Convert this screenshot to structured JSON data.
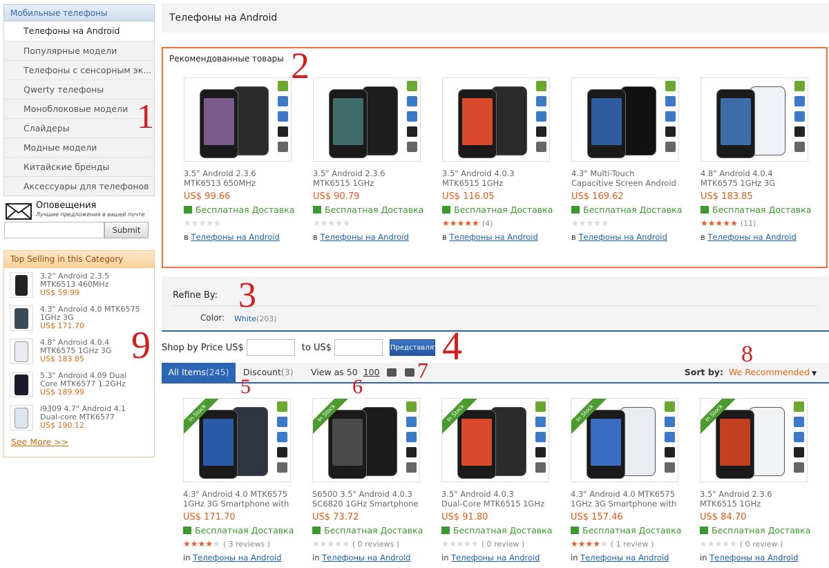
{
  "sidebar": {
    "header": "Мобильные телефоны",
    "items": [
      {
        "label": "Телефоны на Android",
        "active": true
      },
      {
        "label": "Популярные модели"
      },
      {
        "label": "Телефоны с сенсорным эк..."
      },
      {
        "label": "Qwerty телефоны"
      },
      {
        "label": "Моноблоковые модели"
      },
      {
        "label": "Слайдеры"
      },
      {
        "label": "Модные модели"
      },
      {
        "label": "Китайские бренды"
      },
      {
        "label": "Аксессуары для телефонов"
      }
    ]
  },
  "notify": {
    "title": "Оповещения",
    "subtitle": "Лучшие предложения в вашей почте",
    "input_value": "",
    "submit_label": "Submit"
  },
  "top_selling": {
    "header": "Top Selling in this Category",
    "items": [
      {
        "name": "3.2\" Android 2.3.5 MTK6513 460MHz",
        "price": "US$ 59.99"
      },
      {
        "name": "4.3\" Android 4.0 MTK6575 1GHz 3G",
        "price": "US$ 171.70"
      },
      {
        "name": "4.8\" Android 4.0.4 MTK6575 1GHz 3G",
        "price": "US$ 183.85"
      },
      {
        "name": "5.3\" Android 4.09 Dual Core MTK6577 1.2GHz",
        "price": "US$ 189.99"
      },
      {
        "name": "i9309 4.7\" Android 4.1 Dual-core MTK6577",
        "price": "US$ 190.12"
      }
    ],
    "more_label": "See More >>"
  },
  "page_title": "Телефоны на Android",
  "featured": {
    "header": "Рекомендованные товары",
    "products": [
      {
        "name1": "3.5\" Android 2.3.6",
        "name2": "MTK6513 650MHz",
        "price": "US$ 99.66",
        "shipping": "Бесплатная Доставка",
        "rating": 0,
        "count": "",
        "in": "в",
        "category": "Телефоны на Android"
      },
      {
        "name1": "3.5\" Android 2.3.6",
        "name2": "MTK6515 1GHz",
        "price": "US$ 90.79",
        "shipping": "Бесплатная Доставка",
        "rating": 0,
        "count": "",
        "in": "в",
        "category": "Телефоны на Android"
      },
      {
        "name1": "3.5\" Android 4.0.3",
        "name2": "MTK6515 1GHz",
        "price": "US$ 116.05",
        "shipping": "Бесплатная Доставка",
        "rating": 4.5,
        "count": "(4)",
        "in": "в",
        "category": "Телефоны на Android"
      },
      {
        "name1": "4.3\" Multi-Touch",
        "name2": "Capacitive Screen Android",
        "price": "US$ 169.62",
        "shipping": "Бесплатная Доставка",
        "rating": 0,
        "count": "",
        "in": "в",
        "category": "Телефоны на Android"
      },
      {
        "name1": "4.8\" Android 4.0.4",
        "name2": "MTK6575 1GHz 3G",
        "price": "US$ 183.85",
        "shipping": "Бесплатная Доставка",
        "rating": 4.5,
        "count": "(11)",
        "in": "в",
        "category": "Телефоны на Android"
      }
    ]
  },
  "refine": {
    "title": "Refine By:",
    "color_label": "Color:",
    "color_value": "White",
    "color_count": "(203)"
  },
  "price_filter": {
    "label_from": "Shop by Price US$",
    "label_to": "to US$",
    "from_value": "",
    "to_value": "",
    "button": "Представлять"
  },
  "tabs": {
    "all_label": "All Items",
    "all_count": "(245)",
    "discount_label": "Discount",
    "discount_count": "(3)",
    "view_as": "View as",
    "view_50": "50",
    "view_100": "100",
    "sort_label": "Sort by:",
    "sort_value": "We Recommended"
  },
  "listing": {
    "products": [
      {
        "stock": "In Stock",
        "name1": "4.3\" Android 4.0 MTK6575",
        "name2": "1GHz 3G Smartphone with",
        "price": "US$ 171.70",
        "shipping": "Бесплатная Доставка",
        "rating": 4,
        "count": "( 3 reviews )",
        "in": "in",
        "category": "Телефоны на Android"
      },
      {
        "stock": "In Stock",
        "name1": "S6500 3.5\" Android 4.0.3",
        "name2": "SC6820 1GHz Smartphone",
        "price": "US$ 73.72",
        "shipping": "Бесплатная Доставка",
        "rating": 0,
        "count": "( 0 reviews )",
        "in": "in",
        "category": "Телефоны на Android"
      },
      {
        "stock": "In Stock",
        "name1": "3.5\" Android 4.0.3",
        "name2": "Dual-Core MTK6515 1GHz",
        "price": "US$ 91.80",
        "shipping": "Бесплатная Доставка",
        "rating": 0,
        "count": "( 0 review )",
        "in": "in",
        "category": "Телефоны на Android"
      },
      {
        "stock": "In Stock",
        "name1": "4.3\" Android 4.0 MTK6575",
        "name2": "1GHz 3G Smartphone with",
        "price": "US$ 157.46",
        "shipping": "Бесплатная Доставка",
        "rating": 4,
        "count": "( 1 review )",
        "in": "in",
        "category": "Телефоны на Android"
      },
      {
        "stock": "In Stock",
        "name1": "3.5\" Android 2.3.6",
        "name2": "MTK6515 1GHz",
        "price": "US$ 84.70",
        "shipping": "Бесплатная Доставка",
        "rating": 0,
        "count": "( 0 review )",
        "in": "in",
        "category": "Телефоны на Android"
      }
    ]
  },
  "annotations": [
    "1",
    "2",
    "3",
    "4",
    "5",
    "6",
    "7",
    "8",
    "9"
  ],
  "colors": {
    "accent": "#2c66b6",
    "price": "#e25a17",
    "shipping": "#3b9a2d",
    "annotation": "#d41c1c",
    "featured_border": "#ef7339"
  }
}
